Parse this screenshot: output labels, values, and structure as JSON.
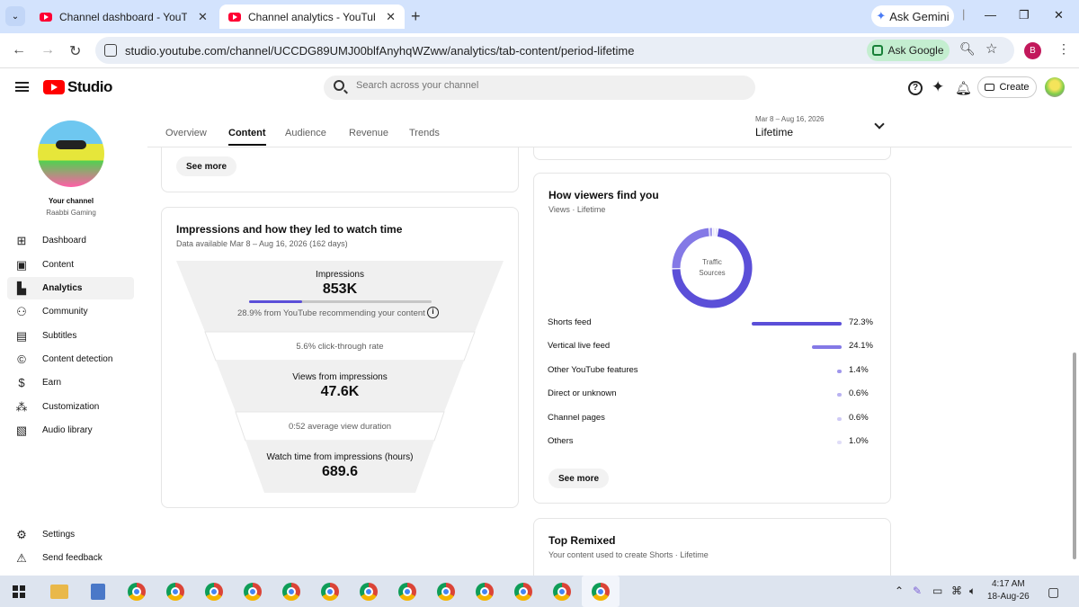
{
  "browser": {
    "tabs": [
      {
        "title": "Channel dashboard - YouTube St"
      },
      {
        "title": "Channel analytics - YouTube St"
      }
    ],
    "gemini_label": "Ask Gemini",
    "url": "studio.youtube.com/channel/UCCDG89UMJ00blfAnyhqWZww/analytics/tab-content/period-lifetime",
    "ask_google_label": "Ask Google",
    "profile_initial": "B"
  },
  "header": {
    "logo": "Studio",
    "search_placeholder": "Search across your channel",
    "create_label": "Create"
  },
  "sidebar": {
    "channel_label": "Your channel",
    "channel_name": "Raabbi Gaming",
    "items": [
      {
        "label": "Dashboard",
        "icon": "dashboard-icon"
      },
      {
        "label": "Content",
        "icon": "content-icon"
      },
      {
        "label": "Analytics",
        "icon": "analytics-icon"
      },
      {
        "label": "Community",
        "icon": "community-icon"
      },
      {
        "label": "Subtitles",
        "icon": "subtitles-icon"
      },
      {
        "label": "Content detection",
        "icon": "copyright-icon"
      },
      {
        "label": "Earn",
        "icon": "dollar-icon"
      },
      {
        "label": "Customization",
        "icon": "magic-wand-icon"
      },
      {
        "label": "Audio library",
        "icon": "audio-library-icon"
      }
    ],
    "bottom_items": [
      {
        "label": "Settings",
        "icon": "gear-icon"
      },
      {
        "label": "Send feedback",
        "icon": "feedback-icon"
      }
    ]
  },
  "tabs": [
    "Overview",
    "Content",
    "Audience",
    "Revenue",
    "Trends"
  ],
  "period": {
    "range": "Mar 8 – Aug 16, 2026",
    "value": "Lifetime"
  },
  "top_card": {
    "see_more": "See more"
  },
  "funnel": {
    "title": "Impressions and how they led to watch time",
    "subtitle": "Data available Mar 8 – Aug 16, 2026 (162 days)",
    "impressions_label": "Impressions",
    "impressions_value": "853K",
    "impressions_note": "28.9% from YouTube recommending your content",
    "impressions_share": 0.289,
    "ctr": "5.6% click-through rate",
    "views_label": "Views from impressions",
    "views_value": "47.6K",
    "avd": "0:52 average view duration",
    "watch_label": "Watch time from impressions (hours)",
    "watch_value": "689.6"
  },
  "traffic": {
    "title": "How viewers find you",
    "subtitle": "Views · Lifetime",
    "donut_label_1": "Traffic",
    "donut_label_2": "Sources",
    "sources": [
      {
        "name": "Shorts feed",
        "pct": "72.3%",
        "value": 72.3,
        "color": "#5b4fd8"
      },
      {
        "name": "Vertical live feed",
        "pct": "24.1%",
        "value": 24.1,
        "color": "#8479e6"
      },
      {
        "name": "Other YouTube features",
        "pct": "1.4%",
        "value": 1.4,
        "color": "#9f96ec"
      },
      {
        "name": "Direct or unknown",
        "pct": "0.6%",
        "value": 0.6,
        "color": "#b9b2f1"
      },
      {
        "name": "Channel pages",
        "pct": "0.6%",
        "value": 0.6,
        "color": "#cfcaf5"
      },
      {
        "name": "Others",
        "pct": "1.0%",
        "value": 1.0,
        "color": "#e0ddf8"
      }
    ],
    "see_more": "See more"
  },
  "remixed": {
    "title": "Top Remixed",
    "subtitle": "Your content used to create Shorts · Lifetime"
  },
  "taskbar": {
    "time": "4:17 AM",
    "date": "18-Aug-26"
  }
}
